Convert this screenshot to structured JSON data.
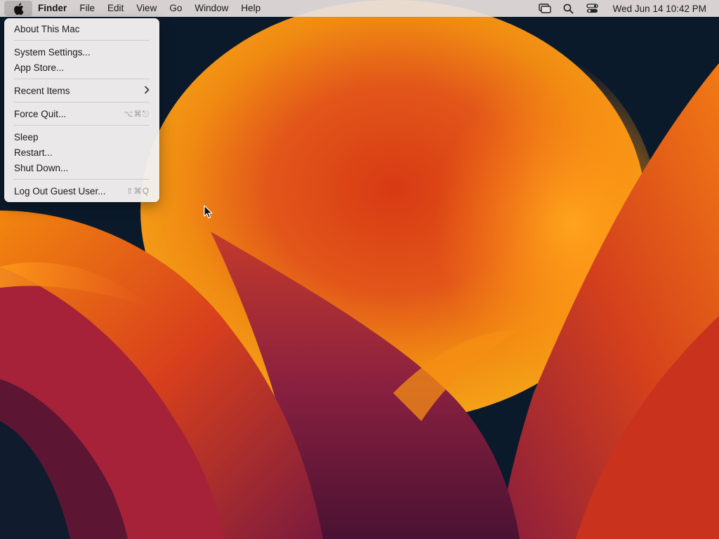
{
  "menubar": {
    "app_name": "Finder",
    "items": [
      "File",
      "Edit",
      "View",
      "Go",
      "Window",
      "Help"
    ],
    "clock": "Wed Jun 14  10:42 PM",
    "icons": [
      "apple-icon",
      "screen-mirroring-icon",
      "spotlight-search-icon",
      "control-center-icon"
    ]
  },
  "apple_menu": {
    "about": "About This Mac",
    "system_settings": "System Settings...",
    "app_store": "App Store...",
    "recent_items": "Recent Items",
    "force_quit": "Force Quit...",
    "force_quit_shortcut": "⌥⌘⎋",
    "sleep": "Sleep",
    "restart": "Restart...",
    "shut_down": "Shut Down...",
    "log_out": "Log Out Guest User...",
    "log_out_shortcut": "⇧⌘Q"
  },
  "colors": {
    "menubar_bg": "#e9e2e0",
    "menu_bg": "#f2efee",
    "wallpaper_dark": "#0b1a2b",
    "wallpaper_orange": "#f28a0c",
    "wallpaper_red": "#c8261a",
    "wallpaper_purple": "#6a1840"
  }
}
